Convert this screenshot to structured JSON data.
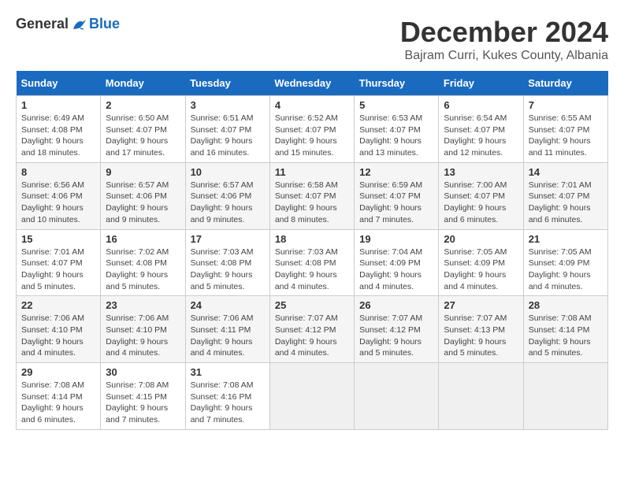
{
  "header": {
    "logo": {
      "general": "General",
      "blue": "Blue"
    },
    "title": "December 2024",
    "location": "Bajram Curri, Kukes County, Albania"
  },
  "weekdays": [
    "Sunday",
    "Monday",
    "Tuesday",
    "Wednesday",
    "Thursday",
    "Friday",
    "Saturday"
  ],
  "weeks": [
    [
      {
        "day": "1",
        "sunrise": "6:49 AM",
        "sunset": "4:08 PM",
        "daylight": "9 hours and 18 minutes."
      },
      {
        "day": "2",
        "sunrise": "6:50 AM",
        "sunset": "4:07 PM",
        "daylight": "9 hours and 17 minutes."
      },
      {
        "day": "3",
        "sunrise": "6:51 AM",
        "sunset": "4:07 PM",
        "daylight": "9 hours and 16 minutes."
      },
      {
        "day": "4",
        "sunrise": "6:52 AM",
        "sunset": "4:07 PM",
        "daylight": "9 hours and 15 minutes."
      },
      {
        "day": "5",
        "sunrise": "6:53 AM",
        "sunset": "4:07 PM",
        "daylight": "9 hours and 13 minutes."
      },
      {
        "day": "6",
        "sunrise": "6:54 AM",
        "sunset": "4:07 PM",
        "daylight": "9 hours and 12 minutes."
      },
      {
        "day": "7",
        "sunrise": "6:55 AM",
        "sunset": "4:07 PM",
        "daylight": "9 hours and 11 minutes."
      }
    ],
    [
      {
        "day": "8",
        "sunrise": "6:56 AM",
        "sunset": "4:06 PM",
        "daylight": "9 hours and 10 minutes."
      },
      {
        "day": "9",
        "sunrise": "6:57 AM",
        "sunset": "4:06 PM",
        "daylight": "9 hours and 9 minutes."
      },
      {
        "day": "10",
        "sunrise": "6:57 AM",
        "sunset": "4:06 PM",
        "daylight": "9 hours and 9 minutes."
      },
      {
        "day": "11",
        "sunrise": "6:58 AM",
        "sunset": "4:07 PM",
        "daylight": "9 hours and 8 minutes."
      },
      {
        "day": "12",
        "sunrise": "6:59 AM",
        "sunset": "4:07 PM",
        "daylight": "9 hours and 7 minutes."
      },
      {
        "day": "13",
        "sunrise": "7:00 AM",
        "sunset": "4:07 PM",
        "daylight": "9 hours and 6 minutes."
      },
      {
        "day": "14",
        "sunrise": "7:01 AM",
        "sunset": "4:07 PM",
        "daylight": "9 hours and 6 minutes."
      }
    ],
    [
      {
        "day": "15",
        "sunrise": "7:01 AM",
        "sunset": "4:07 PM",
        "daylight": "9 hours and 5 minutes."
      },
      {
        "day": "16",
        "sunrise": "7:02 AM",
        "sunset": "4:08 PM",
        "daylight": "9 hours and 5 minutes."
      },
      {
        "day": "17",
        "sunrise": "7:03 AM",
        "sunset": "4:08 PM",
        "daylight": "9 hours and 5 minutes."
      },
      {
        "day": "18",
        "sunrise": "7:03 AM",
        "sunset": "4:08 PM",
        "daylight": "9 hours and 4 minutes."
      },
      {
        "day": "19",
        "sunrise": "7:04 AM",
        "sunset": "4:09 PM",
        "daylight": "9 hours and 4 minutes."
      },
      {
        "day": "20",
        "sunrise": "7:05 AM",
        "sunset": "4:09 PM",
        "daylight": "9 hours and 4 minutes."
      },
      {
        "day": "21",
        "sunrise": "7:05 AM",
        "sunset": "4:09 PM",
        "daylight": "9 hours and 4 minutes."
      }
    ],
    [
      {
        "day": "22",
        "sunrise": "7:06 AM",
        "sunset": "4:10 PM",
        "daylight": "9 hours and 4 minutes."
      },
      {
        "day": "23",
        "sunrise": "7:06 AM",
        "sunset": "4:10 PM",
        "daylight": "9 hours and 4 minutes."
      },
      {
        "day": "24",
        "sunrise": "7:06 AM",
        "sunset": "4:11 PM",
        "daylight": "9 hours and 4 minutes."
      },
      {
        "day": "25",
        "sunrise": "7:07 AM",
        "sunset": "4:12 PM",
        "daylight": "9 hours and 4 minutes."
      },
      {
        "day": "26",
        "sunrise": "7:07 AM",
        "sunset": "4:12 PM",
        "daylight": "9 hours and 5 minutes."
      },
      {
        "day": "27",
        "sunrise": "7:07 AM",
        "sunset": "4:13 PM",
        "daylight": "9 hours and 5 minutes."
      },
      {
        "day": "28",
        "sunrise": "7:08 AM",
        "sunset": "4:14 PM",
        "daylight": "9 hours and 5 minutes."
      }
    ],
    [
      {
        "day": "29",
        "sunrise": "7:08 AM",
        "sunset": "4:14 PM",
        "daylight": "9 hours and 6 minutes."
      },
      {
        "day": "30",
        "sunrise": "7:08 AM",
        "sunset": "4:15 PM",
        "daylight": "9 hours and 7 minutes."
      },
      {
        "day": "31",
        "sunrise": "7:08 AM",
        "sunset": "4:16 PM",
        "daylight": "9 hours and 7 minutes."
      },
      null,
      null,
      null,
      null
    ]
  ]
}
